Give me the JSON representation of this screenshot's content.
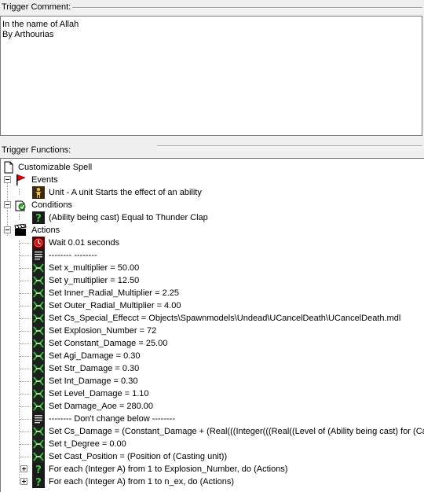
{
  "comment": {
    "label": "Trigger Comment:",
    "lines": [
      "In the name of Allah",
      "By Arthourias"
    ]
  },
  "functions": {
    "label": "Trigger Functions:",
    "root": "Customizable Spell",
    "events": {
      "label": "Events",
      "items": [
        "Unit - A unit Starts the effect of an ability"
      ]
    },
    "conditions": {
      "label": "Conditions",
      "items": [
        "(Ability being cast) Equal to Thunder Clap"
      ]
    },
    "actions": {
      "label": "Actions",
      "items": [
        {
          "text": "Wait 0.01 seconds",
          "icon": "wait-icon"
        },
        {
          "text": "--------   --------",
          "icon": "comment-icon"
        },
        {
          "text": "Set x_multiplier = 50.00",
          "icon": "set-variable-icon"
        },
        {
          "text": "Set y_multiplier = 12.50",
          "icon": "set-variable-icon"
        },
        {
          "text": "Set Inner_Radial_Multiplier = 2.25",
          "icon": "set-variable-icon"
        },
        {
          "text": "Set Outer_Radial_Multiplier = 4.00",
          "icon": "set-variable-icon"
        },
        {
          "text": "Set Cs_Special_Effecct = Objects\\Spawnmodels\\Undead\\UCancelDeath\\UCancelDeath.mdl",
          "icon": "set-variable-icon"
        },
        {
          "text": "Set Explosion_Number = 72",
          "icon": "set-variable-icon"
        },
        {
          "text": "Set Constant_Damage = 25.00",
          "icon": "set-variable-icon"
        },
        {
          "text": "Set Agi_Damage = 0.30",
          "icon": "set-variable-icon"
        },
        {
          "text": "Set Str_Damage = 0.30",
          "icon": "set-variable-icon"
        },
        {
          "text": "Set Int_Damage = 0.30",
          "icon": "set-variable-icon"
        },
        {
          "text": "Set Level_Damage = 1.10",
          "icon": "set-variable-icon"
        },
        {
          "text": "Set Damage_Aoe = 280.00",
          "icon": "set-variable-icon"
        },
        {
          "text": "-------- Don't change below --------",
          "icon": "comment-icon"
        },
        {
          "text": "Set Cs_Damage = (Constant_Damage + (Real(((Integer(((Real((Level of (Ability being cast) for (Casting",
          "icon": "set-variable-icon"
        },
        {
          "text": "Set t_Degree = 0.00",
          "icon": "set-variable-icon"
        },
        {
          "text": "Set Cast_Position = (Position of (Casting unit))",
          "icon": "set-variable-icon"
        },
        {
          "text": "For each (Integer A) from 1 to Explosion_Number, do (Actions)",
          "icon": "loop-icon",
          "expand": true
        },
        {
          "text": "For each (Integer A) from 1 to n_ex, do (Actions)",
          "icon": "loop-icon",
          "expand": true
        }
      ]
    }
  },
  "colors": {
    "flag_red": "#e00000",
    "set_green": "#2fbf2f",
    "set_bg": "#1f1f1f",
    "loop_bg": "#1a1a1a",
    "loop_q": "#3ec83e"
  }
}
